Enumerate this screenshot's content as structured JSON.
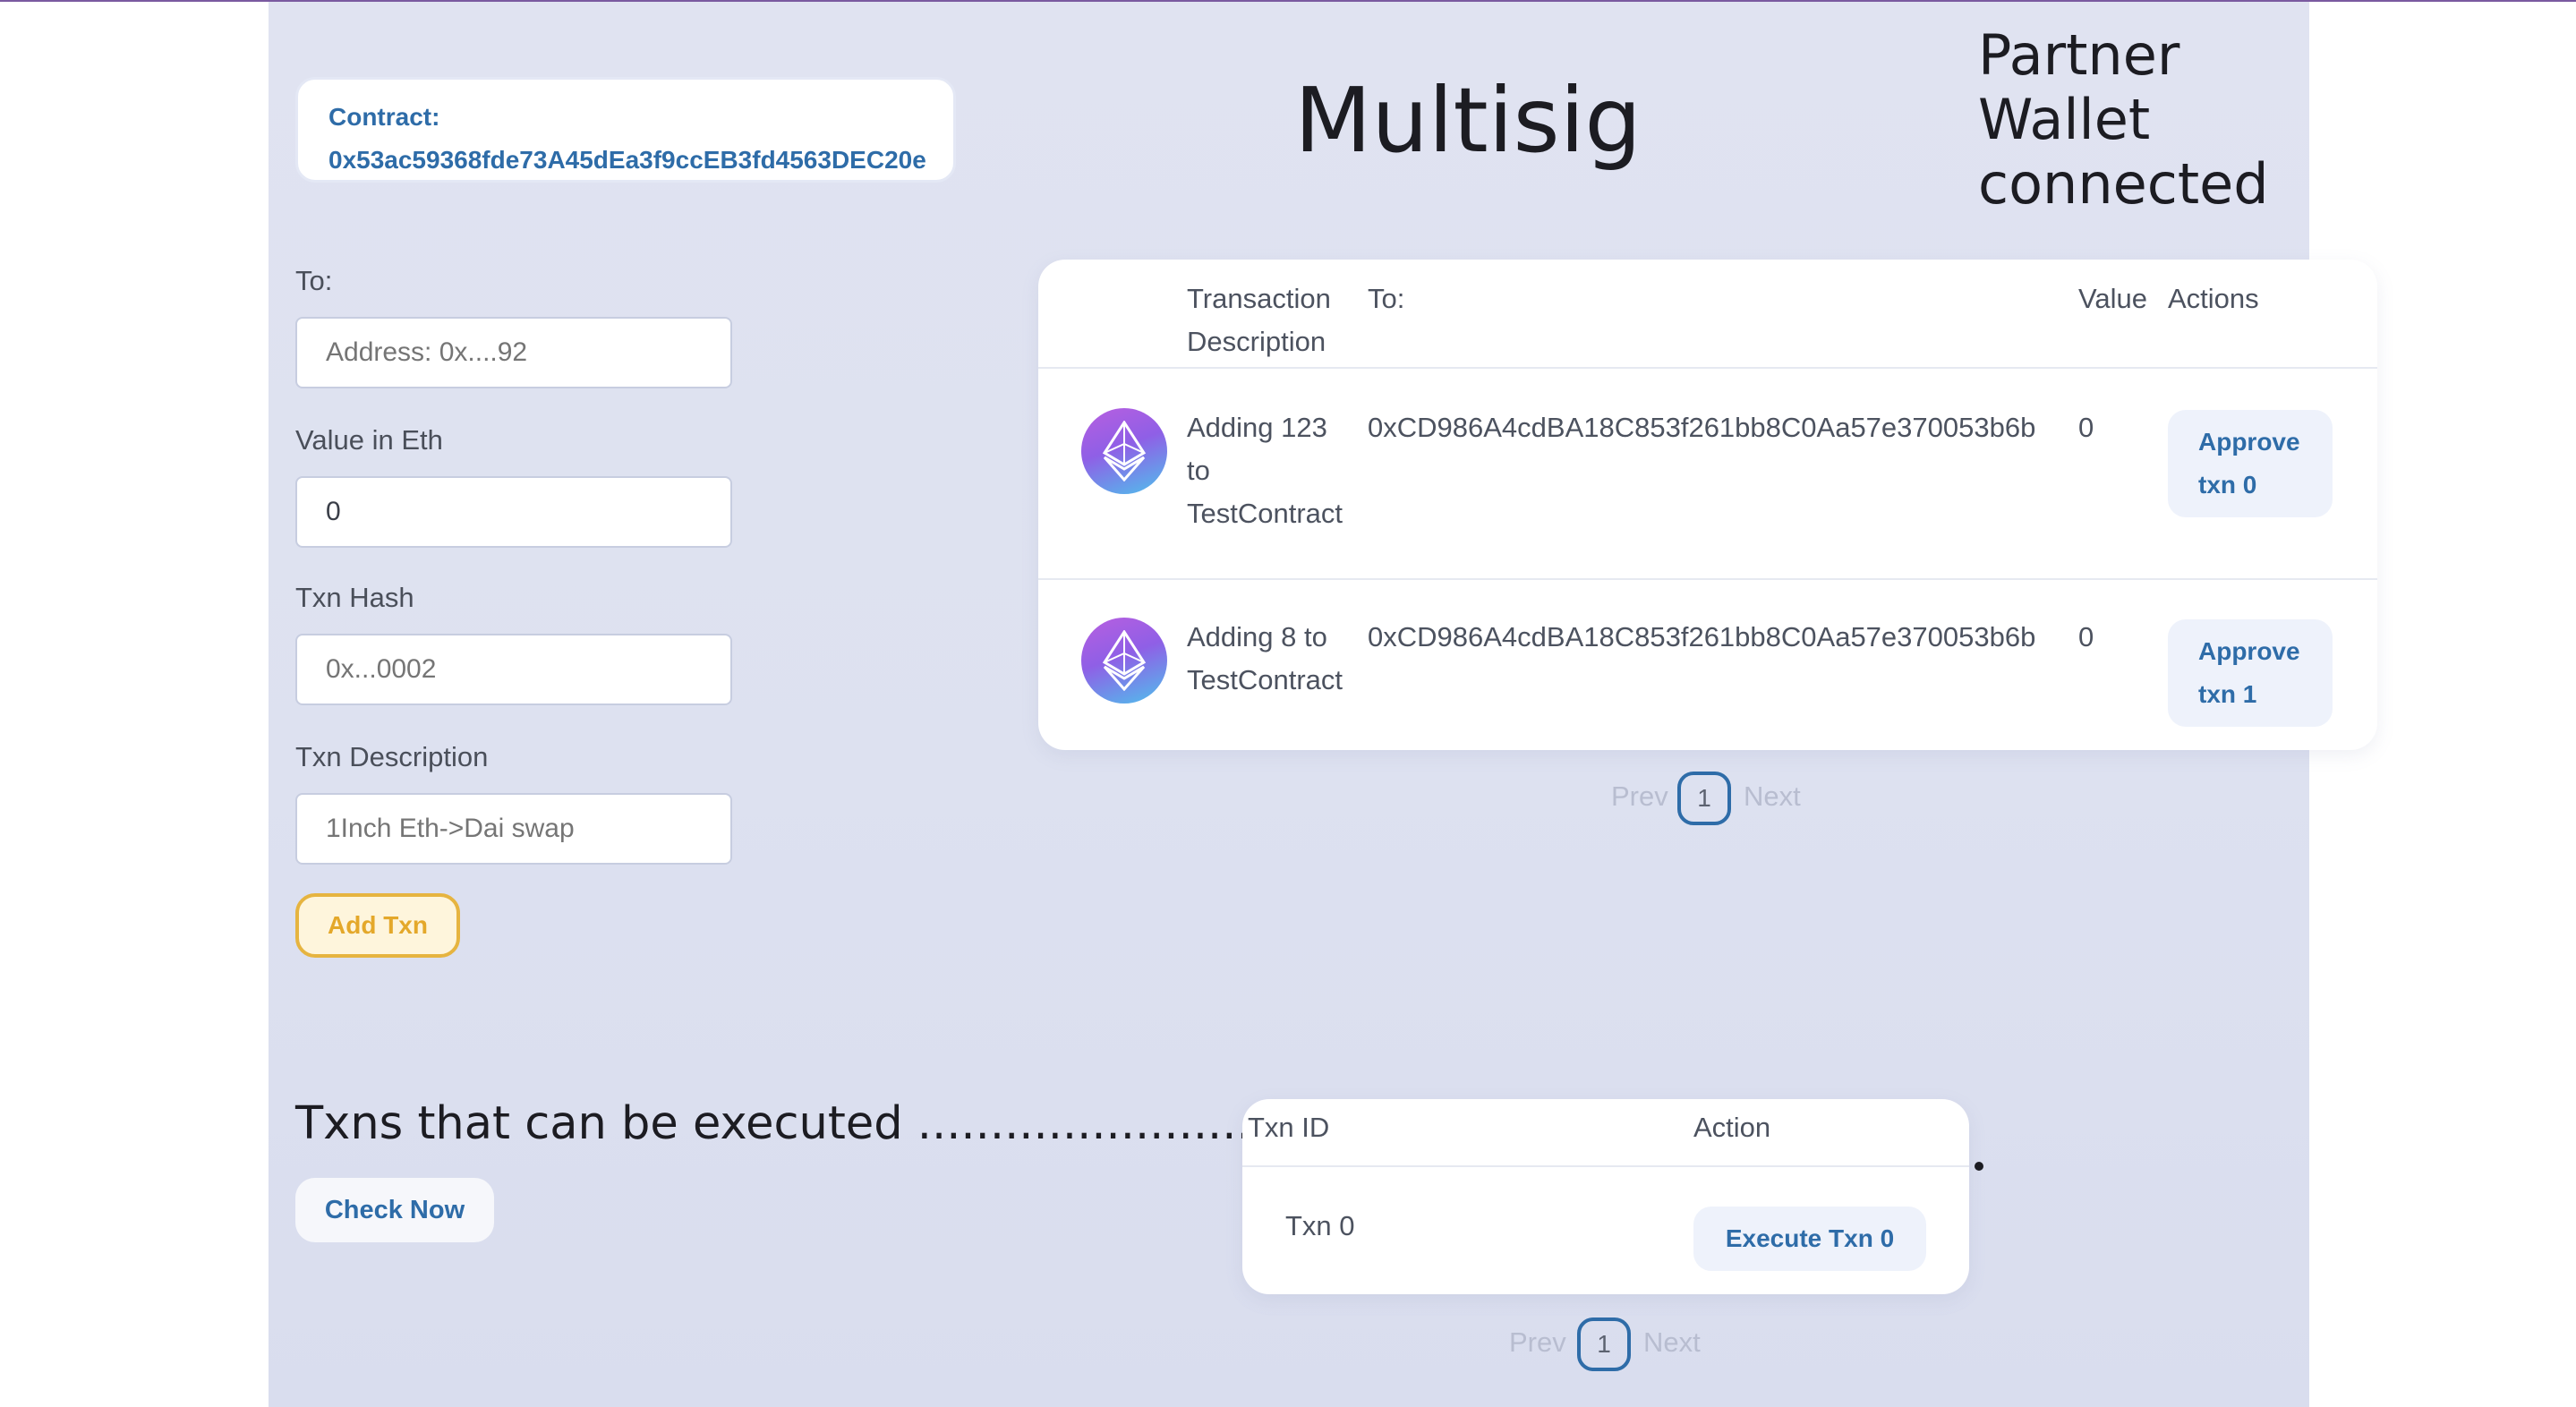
{
  "contract": {
    "label": "Contract:",
    "address": "0x53ac59368fde73A45dEa3f9ccEB3fd4563DEC20e"
  },
  "app_title": "Multisig",
  "wallet": {
    "line1": "Partner",
    "line2": "Wallet",
    "line3": "connected"
  },
  "form": {
    "to_label": "To:",
    "to_placeholder": "Address: 0x....92",
    "value_label": "Value in Eth",
    "value_value": "0",
    "hash_label": "Txn Hash",
    "hash_placeholder": "0x...0002",
    "desc_label": "Txn Description",
    "desc_placeholder": "1Inch Eth->Dai swap",
    "add_button": "Add Txn"
  },
  "tx_table": {
    "headers": {
      "desc_line1": "Transaction",
      "desc_line2": "Description",
      "to": "To:",
      "value": "Value",
      "actions": "Actions"
    },
    "rows": [
      {
        "desc_lines": [
          "Adding 123",
          "to",
          "TestContract"
        ],
        "to": "0xCD986A4cdBA18C853f261bb8C0Aa57e370053b6b",
        "value": "0",
        "approve_line1": "Approve",
        "approve_line2": "txn 0"
      },
      {
        "desc_lines": [
          "Adding 8 to",
          "TestContract"
        ],
        "to": "0xCD986A4cdBA18C853f261bb8C0Aa57e370053b6b",
        "value": "0",
        "approve_line1": "Approve",
        "approve_line2": "txn 1"
      }
    ],
    "pagination": {
      "prev": "Prev",
      "page": "1",
      "next": "Next"
    }
  },
  "executable": {
    "title": "Txns that can be executed .............................. –",
    "check_button": "Check Now",
    "headers": {
      "id": "Txn ID",
      "action": "Action"
    },
    "rows": [
      {
        "id": "Txn 0",
        "button": "Execute Txn 0"
      }
    ],
    "pagination": {
      "prev": "Prev",
      "page": "1",
      "next": "Next"
    }
  },
  "colors": {
    "accent": "#2e6ca8",
    "add_border": "#e6b440",
    "background": "#dfe2f1"
  }
}
